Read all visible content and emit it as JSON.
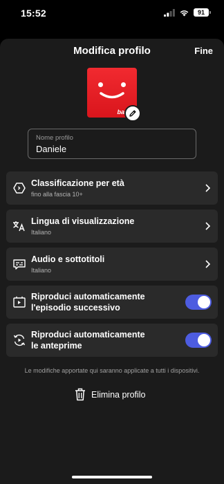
{
  "status_bar": {
    "time": "15:52",
    "battery": "91"
  },
  "header": {
    "title": "Modifica profilo",
    "done_label": "Fine"
  },
  "avatar": {
    "badge_text": "bambi"
  },
  "name_field": {
    "label": "Nome profilo",
    "value": "Daniele"
  },
  "settings": [
    {
      "title": "Classificazione per età",
      "subtitle": "fino alla fascia 10+",
      "icon": "hexagon-rating-icon"
    },
    {
      "title": "Lingua di visualizzazione",
      "subtitle": "Italiano",
      "icon": "translate-icon"
    },
    {
      "title": "Audio e sottotitoli",
      "subtitle": "Italiano",
      "icon": "subtitles-icon"
    }
  ],
  "toggles": [
    {
      "title_line1": "Riproduci automaticamente",
      "title_line2": "l'episodio successivo",
      "enabled": true,
      "icon": "next-episode-icon"
    },
    {
      "title_line1": "Riproduci automaticamente",
      "title_line2": "le anteprime",
      "enabled": true,
      "icon": "autoplay-previews-icon"
    }
  ],
  "footnote": "Le modifiche apportate qui saranno applicate a tutti i dispositivi.",
  "delete_label": "Elimina profilo",
  "colors": {
    "background": "#000000",
    "sheet": "#1b1b1b",
    "row": "#2a2a2a",
    "toggle_on": "#4d5ce0",
    "avatar_red": "#e5141b"
  }
}
